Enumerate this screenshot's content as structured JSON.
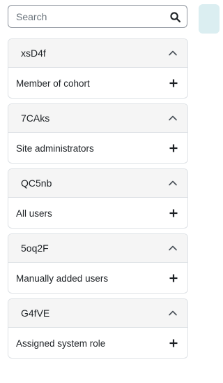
{
  "search": {
    "placeholder": "Search",
    "value": "",
    "icon": "search-icon"
  },
  "filters": [
    {
      "title": "xsD4f",
      "item_label": "Member of cohort",
      "toggle_icon": "chevron-up-icon",
      "add_icon": "plus-icon"
    },
    {
      "title": "7CAks",
      "item_label": "Site administrators",
      "toggle_icon": "chevron-up-icon",
      "add_icon": "plus-icon"
    },
    {
      "title": "QC5nb",
      "item_label": "All users",
      "toggle_icon": "chevron-up-icon",
      "add_icon": "plus-icon"
    },
    {
      "title": "5oq2F",
      "item_label": "Manually added users",
      "toggle_icon": "chevron-up-icon",
      "add_icon": "plus-icon"
    },
    {
      "title": "G4fVE",
      "item_label": "Assigned system role",
      "toggle_icon": "chevron-up-icon",
      "add_icon": "plus-icon"
    }
  ],
  "colors": {
    "border": "#dee2e6",
    "header_bg": "#f5f5f5",
    "text": "#1d2125",
    "accent_tab": "#dbeef1"
  }
}
